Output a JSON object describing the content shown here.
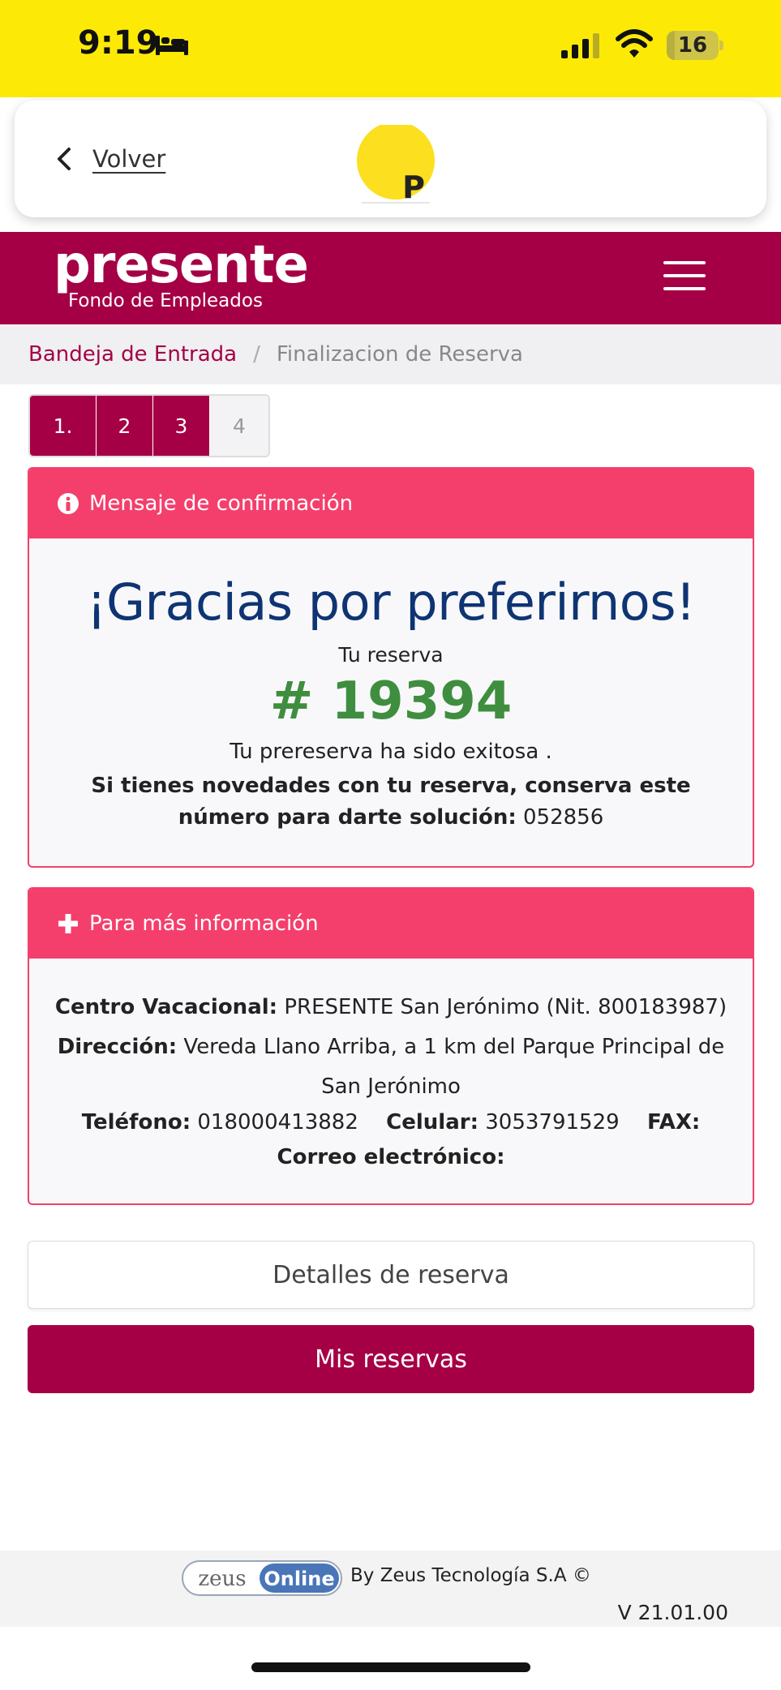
{
  "status_bar": {
    "time": "9:19",
    "battery_level": "16",
    "battery_fraction": 0.16
  },
  "nav": {
    "back_label": "Volver",
    "logo_letter": "P"
  },
  "brand": {
    "name": "presente",
    "subtitle": "Fondo de Empleados"
  },
  "breadcrumb": {
    "home": "Bandeja de Entrada",
    "separator": "/",
    "current": "Finalizacion de Reserva"
  },
  "steps": [
    "1.",
    "2",
    "3",
    "4"
  ],
  "confirmation": {
    "header": "Mensaje de confirmación",
    "thanks": "¡Gracias por preferirnos!",
    "reservation_label": "Tu reserva",
    "reservation_number": "# 19394",
    "success": "Tu prereserva ha sido exitosa .",
    "keep_number_msg": "Si tienes novedades con tu reserva, conserva este número para darte solución:",
    "solution_code": "052856"
  },
  "info": {
    "header": "Para más información",
    "center_label": "Centro Vacacional:",
    "center_value": "PRESENTE San Jerónimo (Nit. 800183987)",
    "address_label": "Dirección:",
    "address_value": "Vereda Llano Arriba, a 1 km del Parque Principal de San Jerónimo",
    "phone_label": "Teléfono:",
    "phone_value": "018000413882",
    "mobile_label": "Celular:",
    "mobile_value": "3053791529",
    "fax_label": "FAX:",
    "email_label": "Correo electrónico:"
  },
  "buttons": {
    "details": "Detalles de reserva",
    "my_reservations": "Mis reservas"
  },
  "footer": {
    "logo_zeus": "zeus",
    "logo_online": "Online",
    "by": "By Zeus Tecnología S.A ©",
    "version": "V 21.01.00"
  },
  "colors": {
    "status_yellow": "#fcea06",
    "brand": "#a50045",
    "panel_header": "#f43f6c",
    "title_blue": "#0e3473",
    "number_green": "#3f8e3f"
  }
}
